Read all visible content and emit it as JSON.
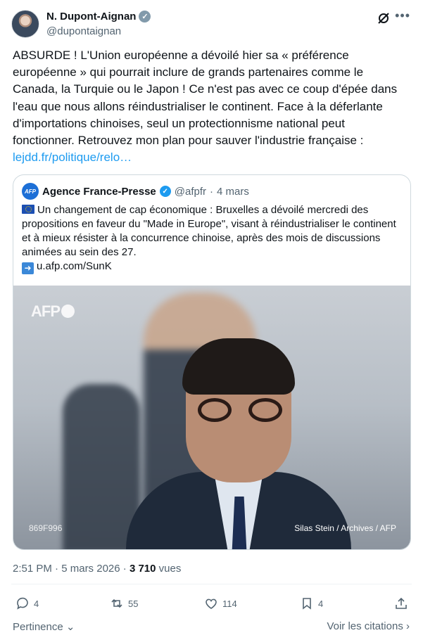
{
  "author": {
    "name": "N. Dupont-Aignan",
    "handle": "@dupontaignan"
  },
  "tweet": {
    "text": "ABSURDE ! L'Union européenne a dévoilé hier sa « préférence européenne » qui pourrait inclure de grands partenaires comme le Canada, la Turquie ou le Japon ! Ce n'est pas avec ce coup d'épée dans l'eau que nous allons réindustrialiser le continent. Face à la déferlante d'importations chinoises, seul un protectionnisme national peut fonctionner. Retrouvez mon plan pour sauver l'industrie française :",
    "link": "lejdd.fr/politique/relo…"
  },
  "quote": {
    "avatar_text": "AFP",
    "name": "Agence France-Presse",
    "handle": "@afpfr",
    "separator": "·",
    "date": "4 mars",
    "text": "Un changement de cap économique : Bruxelles a dévoilé mercredi des propositions en faveur du \"Made in Europe\", visant à réindustrialiser le continent et à mieux résister à la concurrence chinoise, après des mois de discussions animées au sein des 27.",
    "link": "u.afp.com/SunK",
    "photo_watermark": "AFP",
    "photo_id": "869F996",
    "photo_credit": "Silas Stein / Archives / AFP"
  },
  "meta": {
    "time": "2:51 PM",
    "separator": "·",
    "date": "5 mars 2026",
    "separator2": "·",
    "views_count": "3 710",
    "views_label": "vues"
  },
  "actions": {
    "replies": "4",
    "reposts": "55",
    "likes": "114",
    "bookmarks": "4"
  },
  "footer": {
    "sort_label": "Pertinence",
    "citations_label": "Voir les citations"
  },
  "colors": {
    "link": "#1d9bf0",
    "secondary_text": "#536471",
    "border": "#cfd9de"
  },
  "icons": [
    "verified-badge-icon",
    "grok-icon",
    "more-icon",
    "eu-flag-icon",
    "arrow-right-icon",
    "reply-icon",
    "repost-icon",
    "like-icon",
    "bookmark-icon",
    "share-icon",
    "chevron-down-icon",
    "chevron-right-icon"
  ]
}
